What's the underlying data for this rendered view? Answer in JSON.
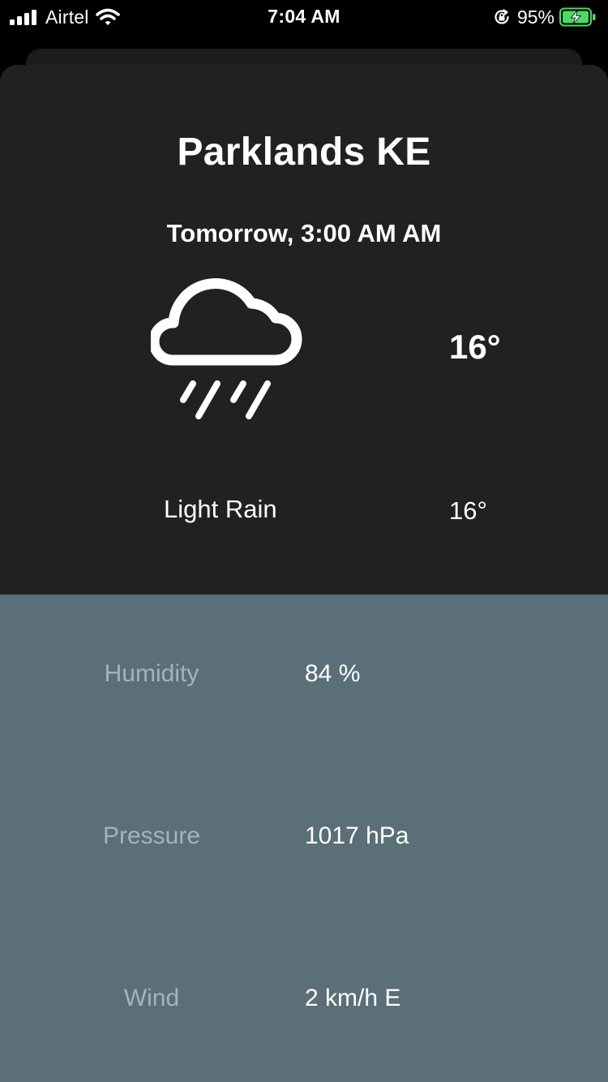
{
  "status_bar": {
    "carrier": "Airtel",
    "time": "7:04 AM",
    "battery_percent": "95%"
  },
  "forecast": {
    "city": "Parklands KE",
    "datetime": "Tomorrow, 3:00 AM AM",
    "icon": "cloud-rain-icon",
    "temperature": "16°",
    "condition": "Light Rain",
    "feels_like": "16°"
  },
  "details": [
    {
      "label": "Humidity",
      "value": "84 %"
    },
    {
      "label": "Pressure",
      "value": "1017 hPa"
    },
    {
      "label": "Wind",
      "value": "2 km/h E"
    }
  ],
  "colors": {
    "top_panel": "#212121",
    "bottom_panel": "#5a6f77",
    "label_text": "#a6b3b9",
    "battery_green": "#4cd964"
  }
}
